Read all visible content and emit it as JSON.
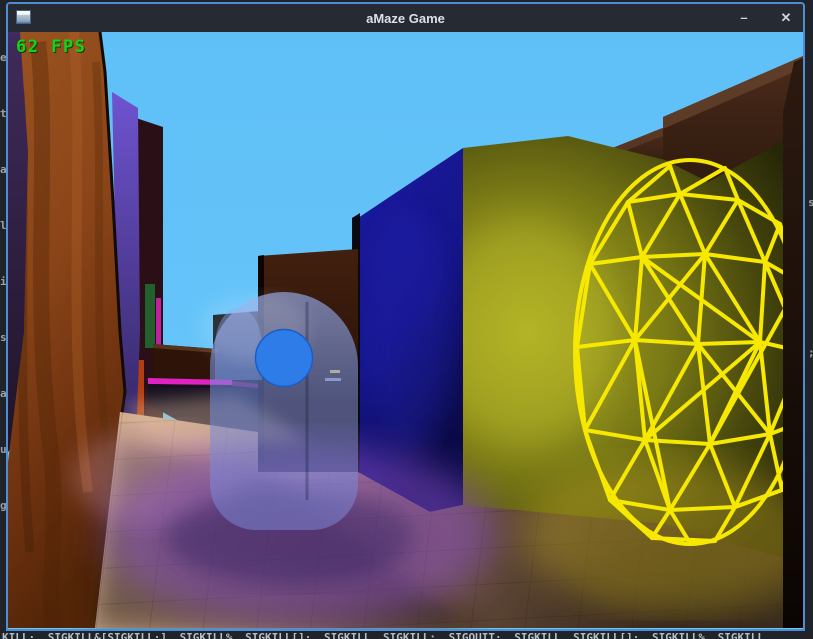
{
  "window": {
    "title": "aMaze Game",
    "minimize_glyph": "–",
    "close_glyph": "✕"
  },
  "hud": {
    "fps": "62 FPS"
  },
  "scene": {
    "view": "first-person-maze",
    "objects": [
      "orange-textured-wall",
      "purple-wall",
      "violet-wall",
      "maroon-corridor-wall",
      "green-wall-sliver",
      "magenta-wall-stripe",
      "red-orange-wall-sliver",
      "navy-cube-face",
      "olive-yellow-cube-face",
      "dark-brown-far-walls",
      "translucent-player-capsule",
      "blue-orb",
      "yellow-wireframe-sphere",
      "textured-floor",
      "purple-floor-glow",
      "yellow-floor-glow"
    ]
  },
  "colors": {
    "window_border": "#4e8ed2",
    "titlebar_bg": "#262b33",
    "title_text": "#dde1e6",
    "desktop_bg": "#20242a",
    "sky": "#61c2f8",
    "fps_green": "#16d316",
    "wireframe_yellow": "#f6e800",
    "capsule_blue": "rgba(112,140,220,0.55)",
    "orb_blue": "#2d7ce8",
    "navy_face": "#16169a",
    "olive_face": "#8a8a1a",
    "orange_wall": "#8a4a1c",
    "magenta_stripe": "#e022c2"
  },
  "background": {
    "left_fragments": "e\nt\na\nl\ni\ns\na\nu\ng",
    "right_fragments": "s\n;",
    "bottom_fragments": "KILL·  SIGKILL&[SIGKILL·]   SIGKILL%  SIGKILL[]·  SIGKILL    SIGKILL:   SIGQUIT·  SIGKILL   SIGKILL[]·  SIGKILL%  SIGKILL"
  }
}
